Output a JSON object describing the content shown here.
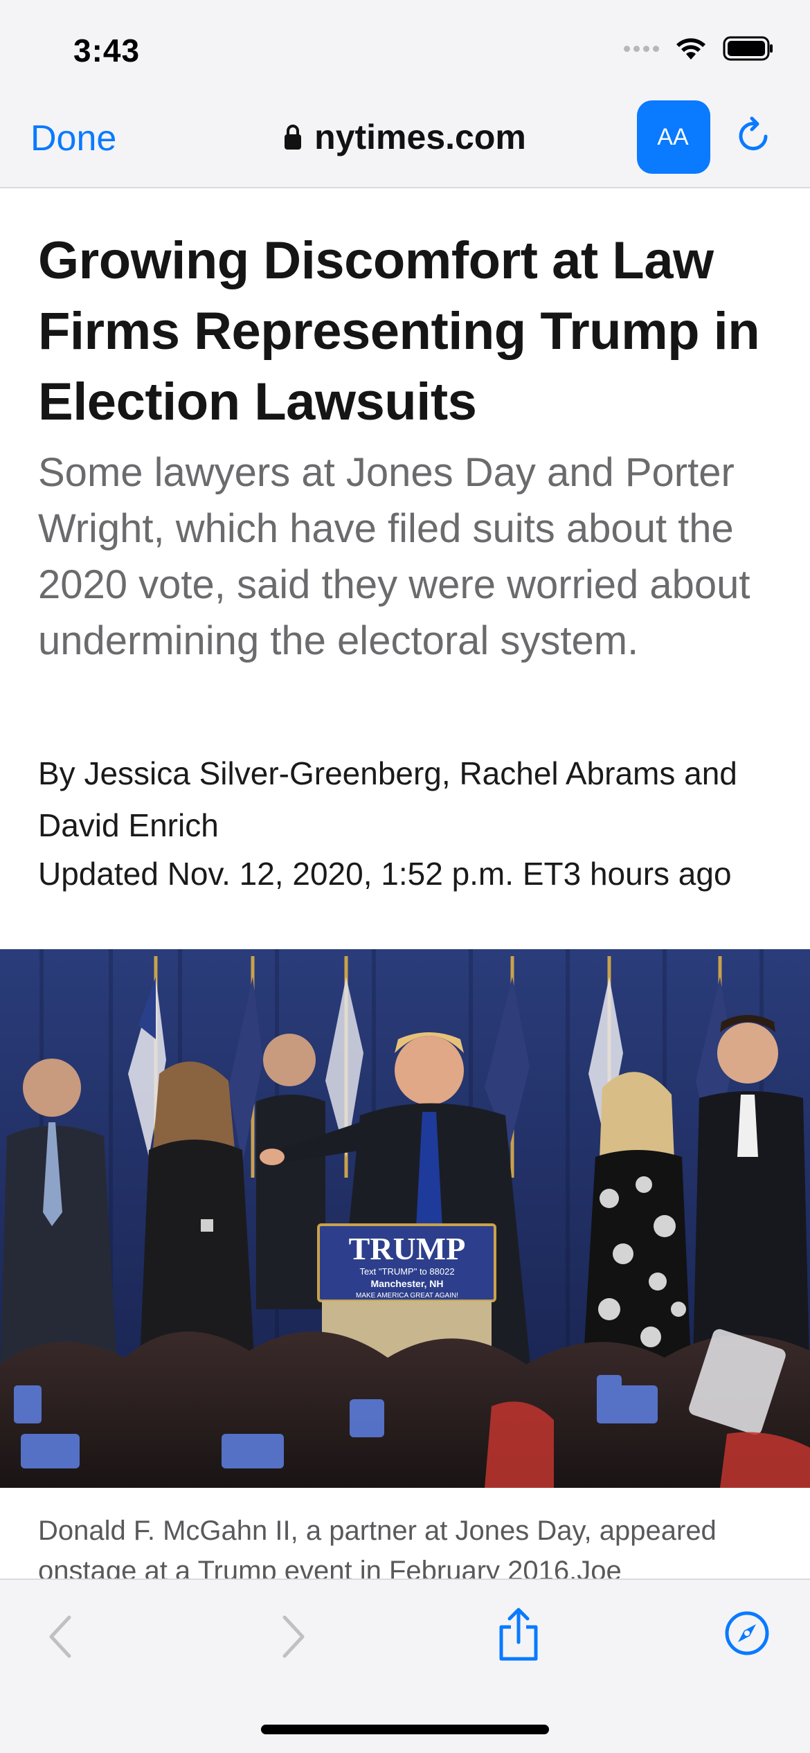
{
  "status_bar": {
    "time": "3:43",
    "icons": [
      "signal-dots-icon",
      "wifi-icon",
      "battery-icon"
    ]
  },
  "nav": {
    "done_label": "Done",
    "url": "nytimes.com",
    "reader_button_label": "AA",
    "icons": [
      "lock-icon",
      "reload-icon"
    ]
  },
  "article": {
    "headline": "Growing Discomfort at Law Firms Representing Trump in Election Lawsuits",
    "summary": "Some lawyers at Jones Day and Porter Wright, which have filed suits about the 2020 vote, said they were worried about undermining the electoral system.",
    "byline": "By Jessica Silver-Greenberg, Rachel Abrams and David Enrich",
    "updated": "Updated Nov. 12, 2020, 1:52 p.m. ET3 hours ago",
    "podium_sign": {
      "name": "TRUMP",
      "line1": "Text \"TRUMP\" to 88022",
      "line2": "Manchester, NH",
      "line3": "MAKE AMERICA GREAT AGAIN!"
    },
    "caption": "Donald F. McGahn II, a partner at Jones Day, appeared onstage at a Trump event in February 2016.Joe"
  },
  "toolbar": {
    "icons": [
      "back-icon",
      "forward-icon",
      "share-icon",
      "compass-icon"
    ]
  },
  "colors": {
    "accent": "#0a7aff",
    "chrome_bg": "#f4f4f6",
    "summary_text": "#6b6b6e"
  }
}
